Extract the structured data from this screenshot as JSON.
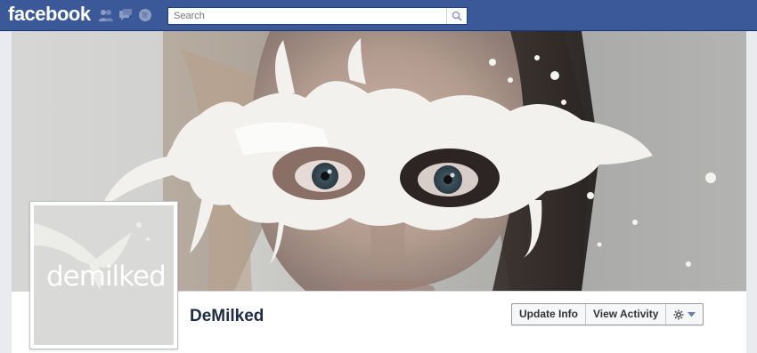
{
  "brand": {
    "logo_text": "facebook"
  },
  "topbar": {
    "jewels": [
      "friend-requests-icon",
      "messages-icon",
      "notifications-icon"
    ],
    "search": {
      "placeholder": "Search",
      "value": "Search"
    }
  },
  "profile": {
    "name": "DeMilked",
    "picture_wordmark": "demilked"
  },
  "actions": {
    "update_info": "Update Info",
    "view_activity": "View Activity",
    "settings": "gear-icon"
  },
  "colors": {
    "brand_blue": "#3b5998",
    "name_text": "#1f2a45"
  }
}
